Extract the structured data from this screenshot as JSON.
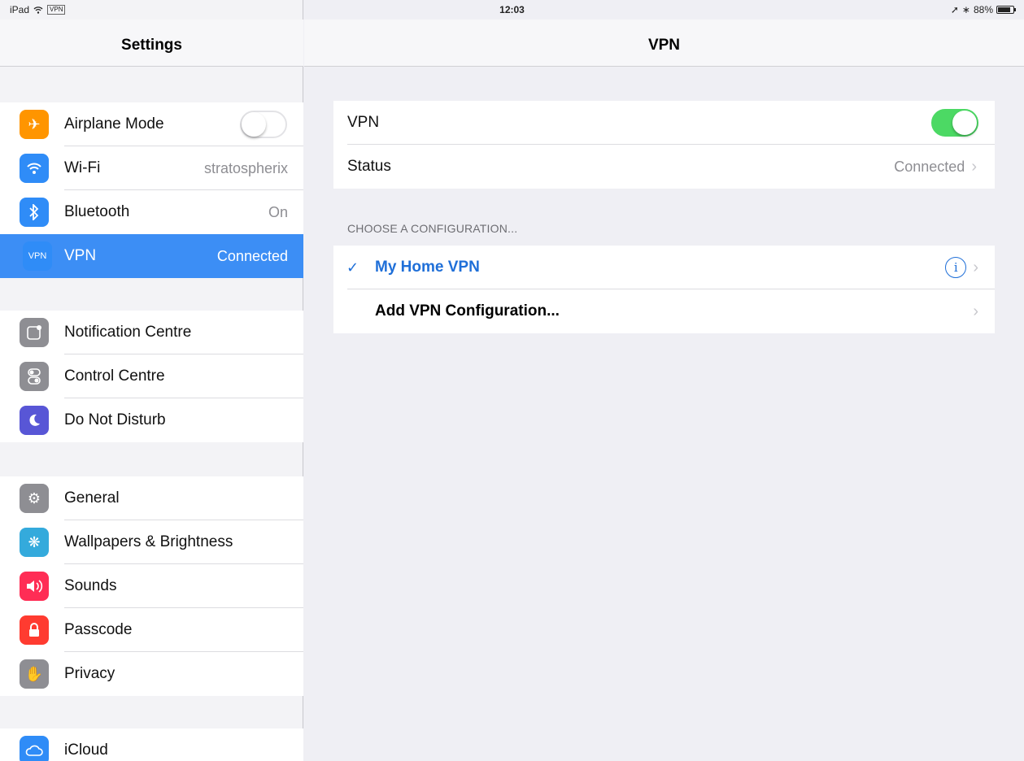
{
  "status_bar": {
    "device": "iPad",
    "wifi_icon": "wifi-icon",
    "vpn_badge": "VPN",
    "time": "12:03",
    "battery_percent": "88%"
  },
  "sidebar": {
    "title": "Settings",
    "groups": [
      {
        "items": [
          {
            "label": "Airplane Mode",
            "icon": "airplane-icon",
            "color": "#ff9500",
            "toggle": false
          },
          {
            "label": "Wi-Fi",
            "icon": "wifi-icon",
            "color": "#2f8cf7",
            "detail": "stratospherix"
          },
          {
            "label": "Bluetooth",
            "icon": "bluetooth-icon",
            "color": "#2f8cf7",
            "detail": "On"
          },
          {
            "label": "VPN",
            "icon": "vpn-icon",
            "color": "#2f8cf7",
            "detail": "Connected",
            "selected": true
          }
        ]
      },
      {
        "items": [
          {
            "label": "Notification Centre",
            "icon": "notification-icon",
            "color": "#8e8e93"
          },
          {
            "label": "Control Centre",
            "icon": "control-centre-icon",
            "color": "#8e8e93"
          },
          {
            "label": "Do Not Disturb",
            "icon": "moon-icon",
            "color": "#5856d6"
          }
        ]
      },
      {
        "items": [
          {
            "label": "General",
            "icon": "gear-icon",
            "color": "#8e8e93"
          },
          {
            "label": "Wallpapers & Brightness",
            "icon": "wallpaper-icon",
            "color": "#34aadc"
          },
          {
            "label": "Sounds",
            "icon": "speaker-icon",
            "color": "#ff2d55"
          },
          {
            "label": "Passcode",
            "icon": "lock-icon",
            "color": "#ff3b30"
          },
          {
            "label": "Privacy",
            "icon": "hand-icon",
            "color": "#8e8e93"
          }
        ]
      },
      {
        "items": [
          {
            "label": "iCloud",
            "icon": "cloud-icon",
            "color": "#2f8cf7"
          }
        ]
      }
    ]
  },
  "detail": {
    "title": "VPN",
    "vpn_toggle": {
      "label": "VPN",
      "on": true
    },
    "status": {
      "label": "Status",
      "value": "Connected"
    },
    "section_title": "CHOOSE A CONFIGURATION...",
    "configurations": [
      {
        "label": "My Home VPN",
        "selected": true
      },
      {
        "label": "Add VPN Configuration..."
      }
    ]
  }
}
